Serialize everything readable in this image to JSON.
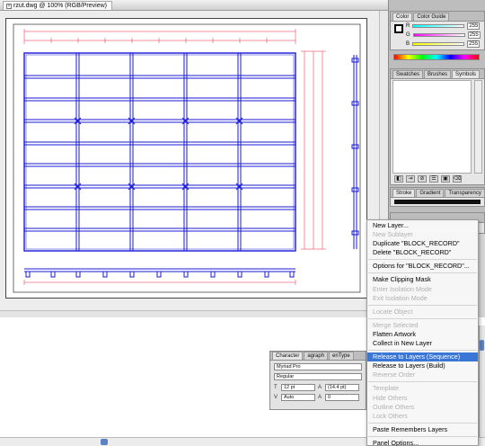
{
  "document": {
    "tab_title": "rzut.dwg @ 100% (RGB/Preview)"
  },
  "color_panel": {
    "tabs": [
      "Color",
      "Color Guide"
    ],
    "channels": [
      {
        "label": "R",
        "value": "255"
      },
      {
        "label": "G",
        "value": "255"
      },
      {
        "label": "B",
        "value": "255"
      }
    ]
  },
  "symbols_panel": {
    "tabs": [
      "Swatches",
      "Brushes",
      "Symbols"
    ]
  },
  "stroke_panel": {
    "tabs": [
      "Stroke",
      "Gradient",
      "Transparency"
    ]
  },
  "context_menu": {
    "items": [
      {
        "label": "New Layer...",
        "state": "enabled"
      },
      {
        "label": "New Sublayer",
        "state": "disabled"
      },
      {
        "label": "Duplicate \"BLOCK_RECORD\"",
        "state": "enabled"
      },
      {
        "label": "Delete \"BLOCK_RECORD\"",
        "state": "enabled"
      },
      {
        "sep": true
      },
      {
        "label": "Options for \"BLOCK_RECORD\"...",
        "state": "enabled"
      },
      {
        "sep": true
      },
      {
        "label": "Make Clipping Mask",
        "state": "enabled"
      },
      {
        "label": "Enter Isolation Mode",
        "state": "disabled"
      },
      {
        "label": "Exit Isolation Mode",
        "state": "disabled"
      },
      {
        "sep": true
      },
      {
        "label": "Locate Object",
        "state": "disabled"
      },
      {
        "sep": true
      },
      {
        "label": "Merge Selected",
        "state": "disabled"
      },
      {
        "label": "Flatten Artwork",
        "state": "enabled"
      },
      {
        "label": "Collect in New Layer",
        "state": "enabled"
      },
      {
        "sep": true
      },
      {
        "label": "Release to Layers (Sequence)",
        "state": "highlighted"
      },
      {
        "label": "Release to Layers (Build)",
        "state": "enabled"
      },
      {
        "label": "Reverse Order",
        "state": "disabled"
      },
      {
        "sep": true
      },
      {
        "label": "Template",
        "state": "disabled"
      },
      {
        "label": "Hide Others",
        "state": "disabled"
      },
      {
        "label": "Outline Others",
        "state": "disabled"
      },
      {
        "label": "Lock Others",
        "state": "disabled"
      },
      {
        "sep": true
      },
      {
        "label": "Paste Remembers Layers",
        "state": "enabled"
      },
      {
        "sep": true
      },
      {
        "label": "Panel Options...",
        "state": "enabled"
      }
    ]
  },
  "character_panel": {
    "tabs": [
      "Character",
      "agraph",
      "enType"
    ],
    "font_family": "Myriad Pro",
    "font_style": "Regular",
    "font_size": "12 pt",
    "leading": "(14.4 pt)",
    "kerning": "Auto",
    "tracking": "0"
  },
  "colors": {
    "menu_highlight": "#3a76d6",
    "drawing_blue": "#1a1ad6",
    "drawing_red": "#e0263a"
  }
}
